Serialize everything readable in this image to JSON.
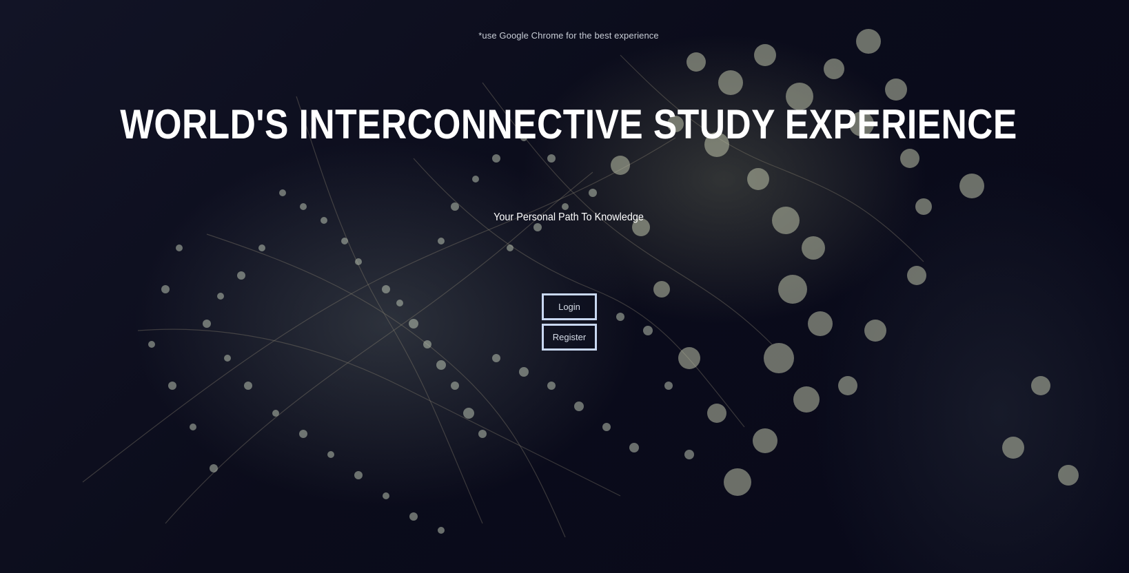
{
  "page": {
    "browser_notice": "*use Google Chrome for the best experience",
    "title": "WORLD'S INTERCONNECTIVE STUDY EXPERIENCE",
    "tagline": "Your Personal Path To Knowledge"
  },
  "actions": {
    "login_label": "Login",
    "register_label": "Register"
  },
  "colors": {
    "background": "#0c0d1c",
    "text": "#ffffff",
    "notice_text": "#c8cdd6",
    "button_border": "#c9d8f2",
    "button_text": "#d7dde8"
  }
}
